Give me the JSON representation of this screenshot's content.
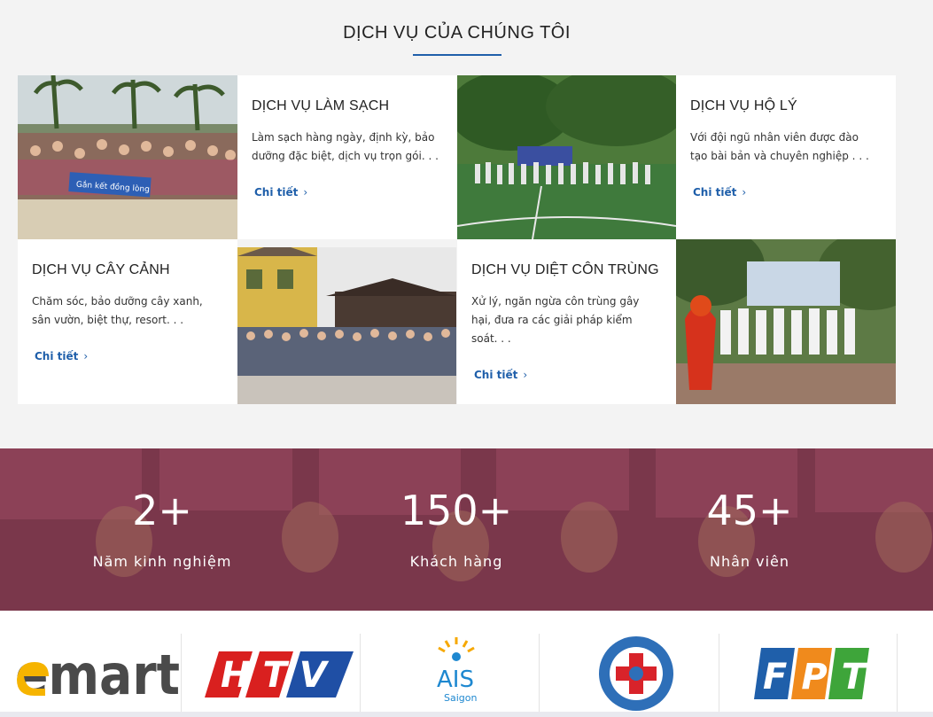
{
  "section": {
    "title": "DỊCH VỤ CỦA CHÚNG TÔI"
  },
  "services": [
    {
      "title": "DỊCH VỤ LÀM SẠCH",
      "description": "Làm sạch hàng ngày, định kỳ, bảo dưỡng đặc biệt, dịch vụ trọn gói. . .",
      "link_label": "Chi tiết"
    },
    {
      "title": "DỊCH VỤ HỘ LÝ",
      "description": "Với đội ngũ nhân viên được đào tạo bài bản và chuyên nghiệp . . .",
      "link_label": "Chi tiết"
    },
    {
      "title": "DỊCH VỤ CÂY CẢNH",
      "description": "Chăm sóc, bảo dưỡng cây xanh, sân vườn, biệt thự, resort. . .",
      "link_label": "Chi tiết"
    },
    {
      "title": "DỊCH VỤ DIỆT CÔN TRÙNG",
      "description": "Xử lý, ngăn ngừa côn trùng gây hại, đưa ra các giải pháp kiểm soát. . .",
      "link_label": "Chi tiết"
    }
  ],
  "photo_banners": {
    "beach_banner": "Gắn kết đồng lòng"
  },
  "stats": [
    {
      "value": "2+",
      "label": "Năm kinh nghiệm"
    },
    {
      "value": "150+",
      "label": "Khách hàng"
    },
    {
      "value": "45+",
      "label": "Nhân viên"
    }
  ],
  "partners": {
    "emart": "emart",
    "htv": "HTV",
    "ais": "AIS",
    "ais_sub": "Saigon",
    "fpt": "FPT"
  },
  "colors": {
    "accent": "#1f5faa",
    "stats_band": "#9a4a60"
  }
}
